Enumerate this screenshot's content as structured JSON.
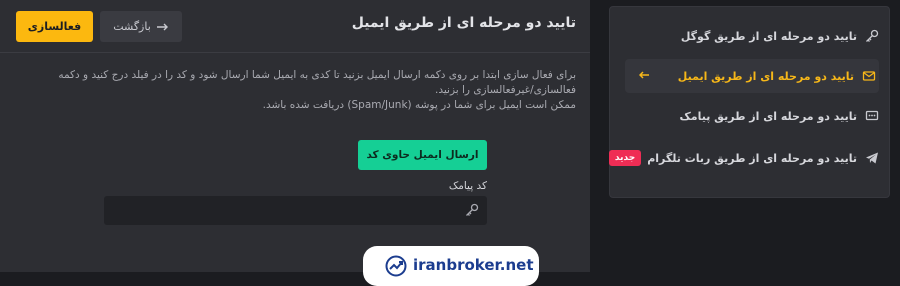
{
  "main": {
    "title": "تایید دو مرحله ای از طریق ایمیل",
    "activate_label": "فعالسازی",
    "back_label": "بازگشت",
    "description": [
      "برای فعال سازی ابتدا بر روی دکمه ارسال ایمیل بزنید تا کدی به ایمیل شما ارسال شود و کد را در فیلد درج کنید و دکمه",
      "فعالسازی/غیرفعالسازی را بزنید.",
      "ممکن است ایمیل برای شما در پوشه (Spam/Junk) دریافت شده باشد."
    ],
    "send_email_label": "ارسال ایمیل حاوی کد",
    "code_label": "کد پیامک",
    "code_value": ""
  },
  "sidebar": {
    "items": [
      {
        "label": "تایید دو مرحله ای از طریق گوگل",
        "icon": "key-icon",
        "active": false
      },
      {
        "label": "تایید دو مرحله ای از طریق ایمیل",
        "icon": "envelope-icon",
        "active": true
      },
      {
        "label": "تایید دو مرحله ای از طریق پیامک",
        "icon": "sms-icon",
        "active": false
      },
      {
        "label": "تایید دو مرحله ای از طریق ربات تلگرام",
        "icon": "telegram-icon",
        "active": false,
        "badge": "جدید"
      }
    ]
  },
  "watermark": {
    "text": "iranbroker.net"
  },
  "colors": {
    "accent": "#fcb80f",
    "success": "#15cf95",
    "badge": "#ef2d55",
    "panel": "#2d2e33",
    "background": "#1b1c20"
  }
}
